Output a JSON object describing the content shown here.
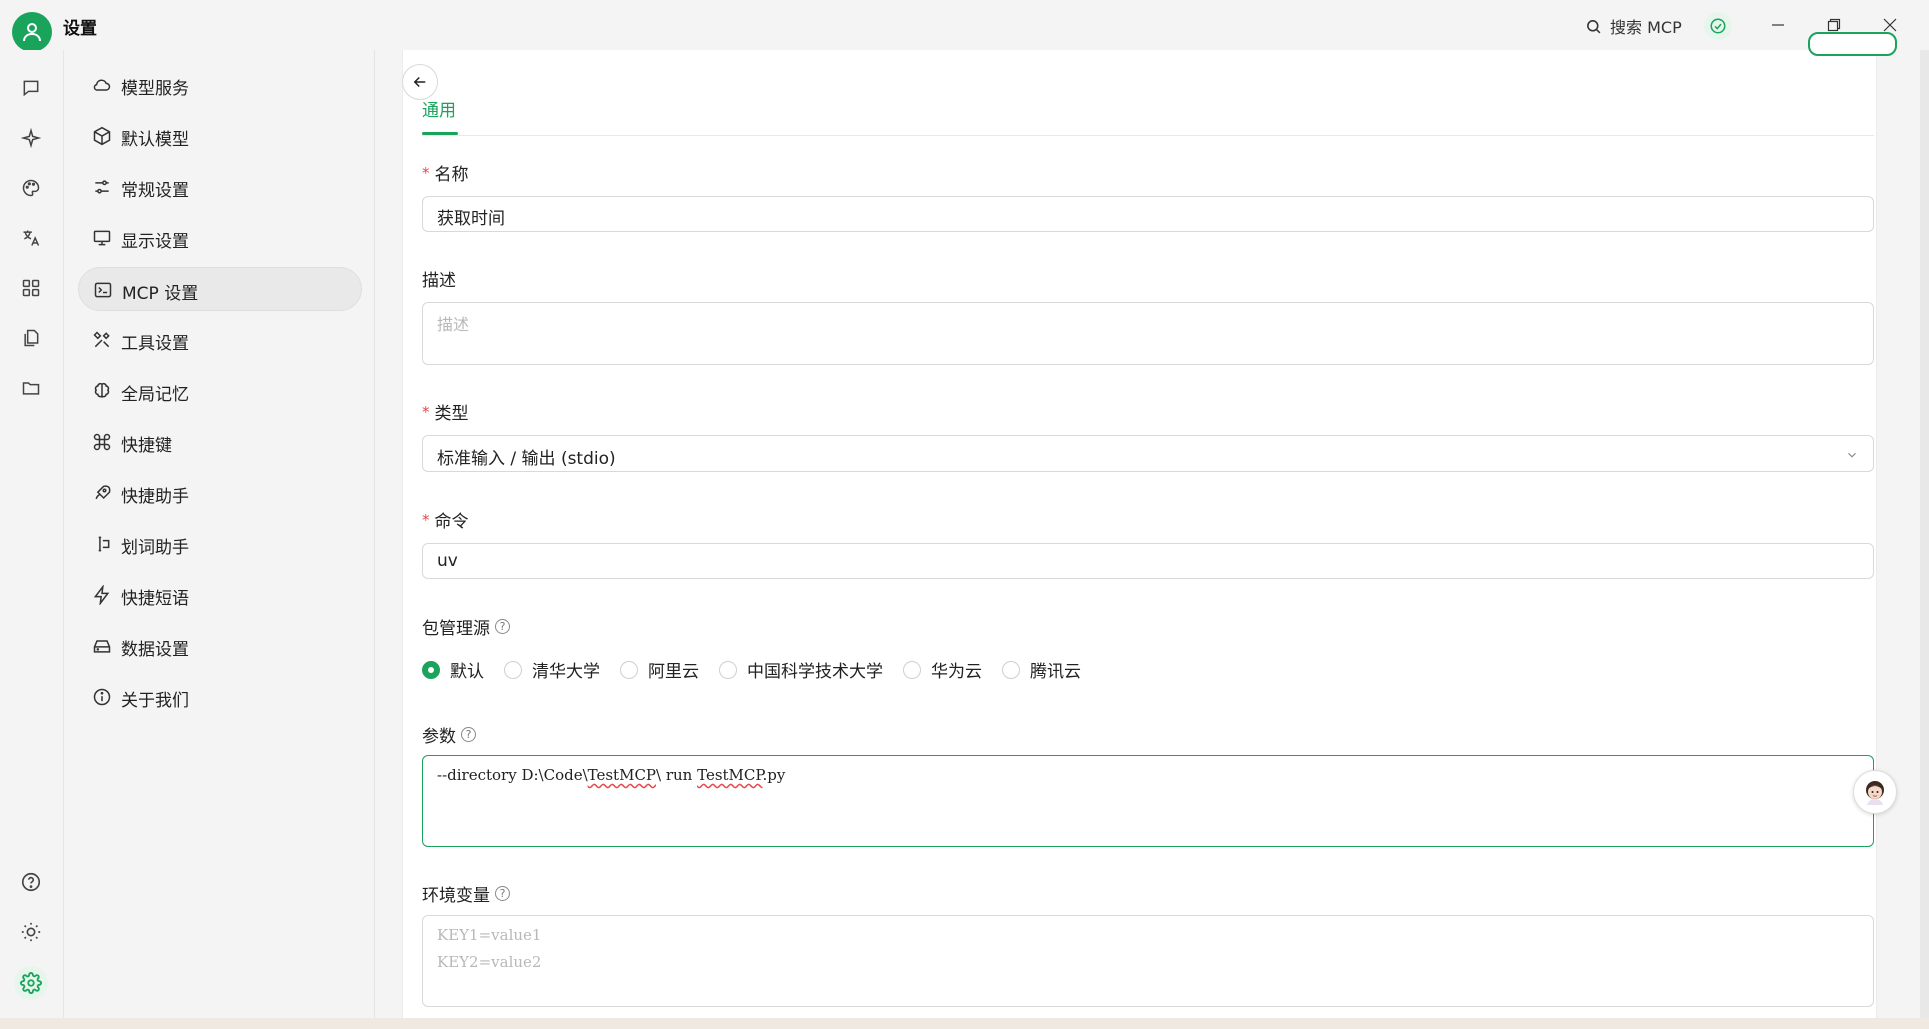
{
  "titlebar": {
    "title": "设置",
    "search_label": "搜索 MCP",
    "colors": {
      "accent": "#1aa35b"
    }
  },
  "rail": {
    "items": [
      "chat-icon",
      "sparkle-icon",
      "palette-icon",
      "translate-icon",
      "apps-grid-icon",
      "file-copy-icon",
      "folder-icon"
    ],
    "bottom": [
      "help-icon",
      "theme-icon",
      "settings-icon"
    ]
  },
  "nav": {
    "items": [
      {
        "label": "模型服务",
        "icon": "cloud-icon"
      },
      {
        "label": "默认模型",
        "icon": "cube-icon"
      },
      {
        "label": "常规设置",
        "icon": "sliders-icon"
      },
      {
        "label": "显示设置",
        "icon": "monitor-icon"
      },
      {
        "label": "MCP 设置",
        "icon": "terminal-icon",
        "active": true
      },
      {
        "label": "工具设置",
        "icon": "tools-icon"
      },
      {
        "label": "全局记忆",
        "icon": "brain-icon"
      },
      {
        "label": "快捷键",
        "icon": "command-icon"
      },
      {
        "label": "快捷助手",
        "icon": "rocket-icon"
      },
      {
        "label": "划词助手",
        "icon": "text-cursor-icon"
      },
      {
        "label": "快捷短语",
        "icon": "zap-icon"
      },
      {
        "label": "数据设置",
        "icon": "storage-icon"
      },
      {
        "label": "关于我们",
        "icon": "info-icon"
      }
    ]
  },
  "form": {
    "tab": "通用",
    "name": {
      "label": "名称",
      "value": "获取时间",
      "required": true
    },
    "description": {
      "label": "描述",
      "placeholder": "描述"
    },
    "type": {
      "label": "类型",
      "value": "标准输入 / 输出 (stdio)",
      "required": true
    },
    "command": {
      "label": "命令",
      "value": "uv",
      "required": true
    },
    "registry": {
      "label": "包管理源",
      "options": [
        "默认",
        "清华大学",
        "阿里云",
        "中国科学技术大学",
        "华为云",
        "腾讯云"
      ],
      "selected": "默认"
    },
    "args": {
      "label": "参数",
      "value": "--directory D:\\Code\\TestMCP\\ run TestMCP.py",
      "p1": "--directory D:\\Code\\",
      "p2": "TestMCP",
      "p3": "\\ run ",
      "p4": "TestMCP",
      "p5": ".py"
    },
    "env": {
      "label": "环境变量",
      "placeholder_line1": "KEY1=value1",
      "placeholder_line2": "KEY2=value2"
    }
  }
}
